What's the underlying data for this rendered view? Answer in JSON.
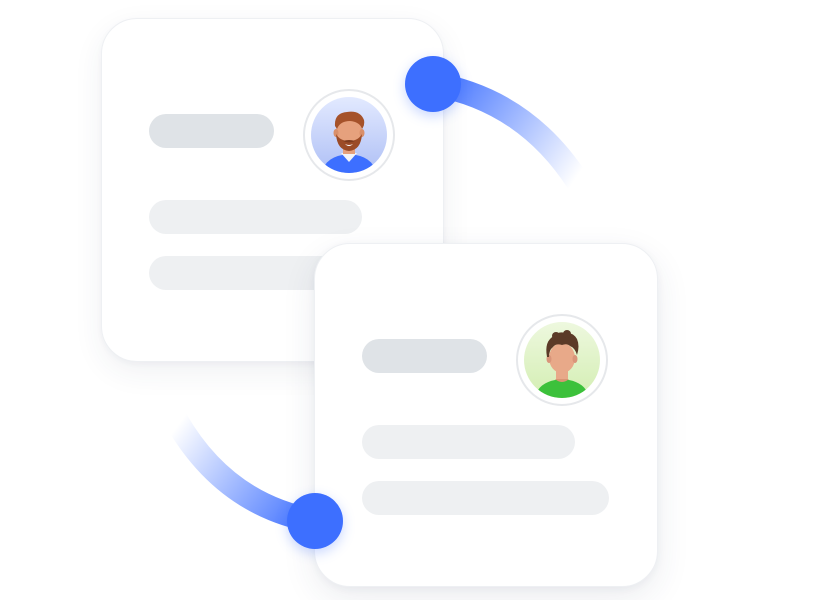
{
  "colors": {
    "accent": "#3d6fff",
    "card_border": "#eef0f3",
    "title_bar": "#dfe3e7",
    "text_bar": "#eef0f2"
  },
  "cards": [
    {
      "avatar": {
        "icon": "bearded-man-avatar",
        "background": "#c7d4fb"
      }
    },
    {
      "avatar": {
        "icon": "curly-hair-man-avatar",
        "background": "#def3c6"
      }
    }
  ]
}
